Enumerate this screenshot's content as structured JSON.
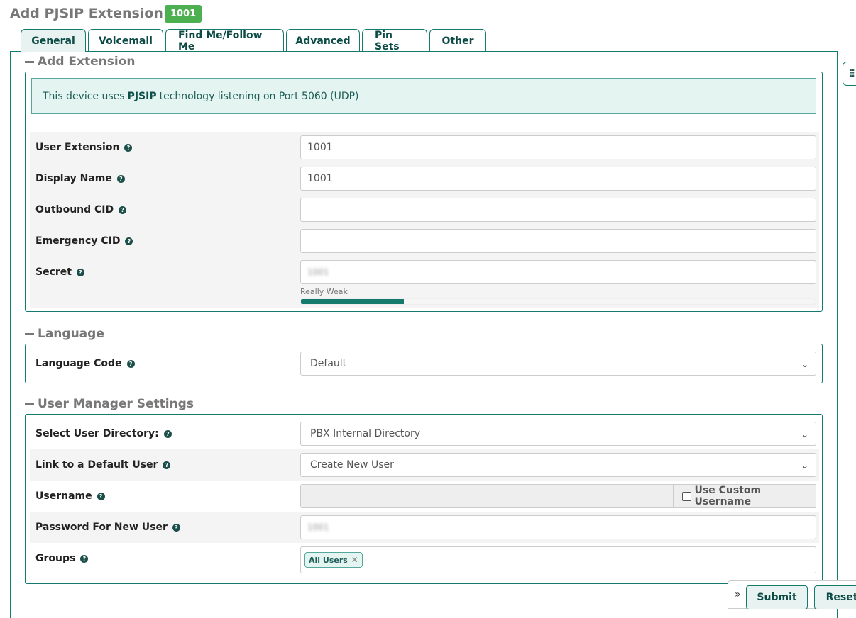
{
  "page": {
    "title": "Add PJSIP Extension",
    "extension_badge": "1001"
  },
  "tabs": [
    {
      "label": "General",
      "active": true
    },
    {
      "label": "Voicemail",
      "active": false
    },
    {
      "label": "Find Me/Follow Me",
      "active": false
    },
    {
      "label": "Advanced",
      "active": false
    },
    {
      "label": "Pin Sets",
      "active": false
    },
    {
      "label": "Other",
      "active": false
    }
  ],
  "add_extension": {
    "heading": "Add Extension",
    "alert": {
      "prefix": "This device uses",
      "tech": "PJSIP",
      "suffix": "technology listening on Port 5060 (UDP)"
    },
    "fields": {
      "user_extension": {
        "label": "User Extension",
        "value": "1001"
      },
      "display_name": {
        "label": "Display Name",
        "value": "1001"
      },
      "outbound_cid": {
        "label": "Outbound CID",
        "value": ""
      },
      "emergency_cid": {
        "label": "Emergency CID",
        "value": ""
      },
      "secret": {
        "label": "Secret",
        "value": "1001",
        "strength_label": "Really Weak",
        "strength_fraction": 0.2
      }
    }
  },
  "language": {
    "heading": "Language",
    "language_code": {
      "label": "Language Code",
      "selected": "Default"
    }
  },
  "user_manager": {
    "heading": "User Manager Settings",
    "directory": {
      "label": "Select User Directory:",
      "selected": "PBX Internal Directory"
    },
    "default_user": {
      "label": "Link to a Default User",
      "selected": "Create New User"
    },
    "username": {
      "label": "Username",
      "value": "",
      "custom_label": "Use Custom Username",
      "custom_checked": false
    },
    "password": {
      "label": "Password For New User",
      "value": "1001"
    },
    "groups": {
      "label": "Groups",
      "tags": [
        "All Users"
      ]
    }
  },
  "actions": {
    "submit": "Submit",
    "reset": "Reset"
  },
  "colors": {
    "accent": "#157a6e",
    "badge": "#4caf50",
    "alert_bg": "#e4f4f1"
  }
}
